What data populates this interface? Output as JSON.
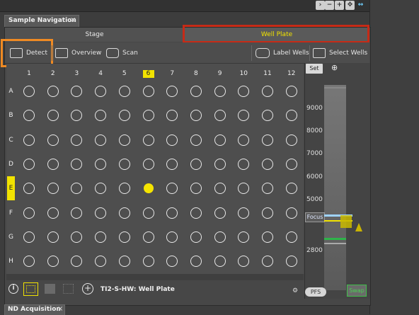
{
  "panel": {
    "title": "Sample Navigation",
    "close": "×"
  },
  "mode_tabs": {
    "stage": "Stage",
    "well_plate": "Well Plate"
  },
  "toolbar": {
    "detect": "Detect",
    "overview": "Overview",
    "scan": "Scan",
    "label_wells": "Label Wells",
    "select_wells": "Select Wells"
  },
  "plate": {
    "columns": [
      "1",
      "2",
      "3",
      "4",
      "5",
      "6",
      "7",
      "8",
      "9",
      "10",
      "11",
      "12"
    ],
    "rows": [
      "A",
      "B",
      "C",
      "D",
      "E",
      "F",
      "G",
      "H"
    ],
    "selected_column": "6",
    "selected_row": "E",
    "active_well": "E6"
  },
  "focus": {
    "set": "Set",
    "scale": [
      "9000",
      "8000",
      "7000",
      "6000",
      "5000",
      "2800"
    ],
    "focus_label": "Focus",
    "pfs": "PFS",
    "swap": "Swap"
  },
  "bottom": {
    "info": "i",
    "device": "TI2-S-HW: Well Plate"
  },
  "bottom_tab": {
    "title": "ND Acquisition",
    "close": "×"
  },
  "colors": {
    "accent_yellow": "#f2e300",
    "highlight_red": "#c62b17",
    "highlight_orange": "#ef8a23",
    "swap_green": "#3fbe49"
  }
}
